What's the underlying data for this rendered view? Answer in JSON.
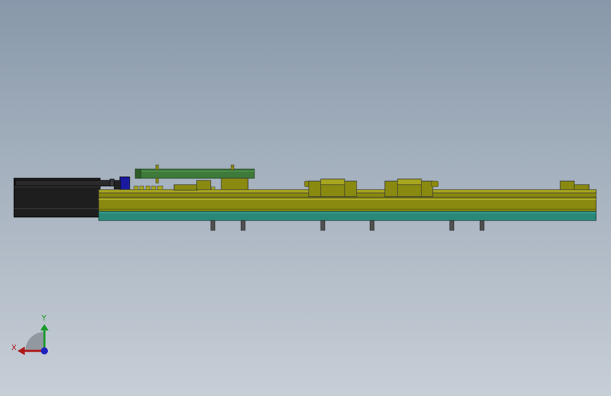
{
  "viewport": {
    "colors": {
      "olive": "#8a8a10",
      "olive_dark": "#5a5a08",
      "olive_light": "#a8a620",
      "teal": "#2a8878",
      "green_plate": "#3e7a3a",
      "motor_black": "#1e1e1e",
      "blue_block": "#1a1aa0",
      "bolt_gray": "#505050",
      "bg_top": "#8898aa",
      "bg_bottom": "#c7ced6"
    }
  },
  "triad": {
    "x_label": "X",
    "y_label": "Y",
    "x_color": "#b01818",
    "y_color": "#1a9a2a",
    "z_color": "#2020c0"
  }
}
